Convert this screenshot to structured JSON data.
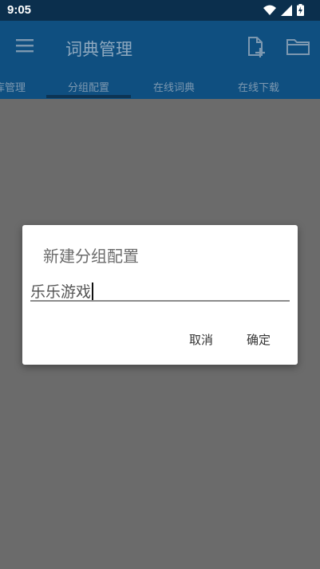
{
  "status": {
    "time": "9:05"
  },
  "app_bar": {
    "title": "词典管理"
  },
  "tabs": [
    {
      "label": "库管理"
    },
    {
      "label": "分组配置"
    },
    {
      "label": "在线词典"
    },
    {
      "label": "在线下载"
    }
  ],
  "dialog": {
    "title": "新建分组配置",
    "input_value": "乐乐游戏",
    "cancel_label": "取消",
    "ok_label": "确定"
  },
  "colors": {
    "status_bar": "#0b2f4d",
    "app_bar": "#0f4f80",
    "scrim": "#6b6b6b",
    "dialog": "#ffffff"
  }
}
